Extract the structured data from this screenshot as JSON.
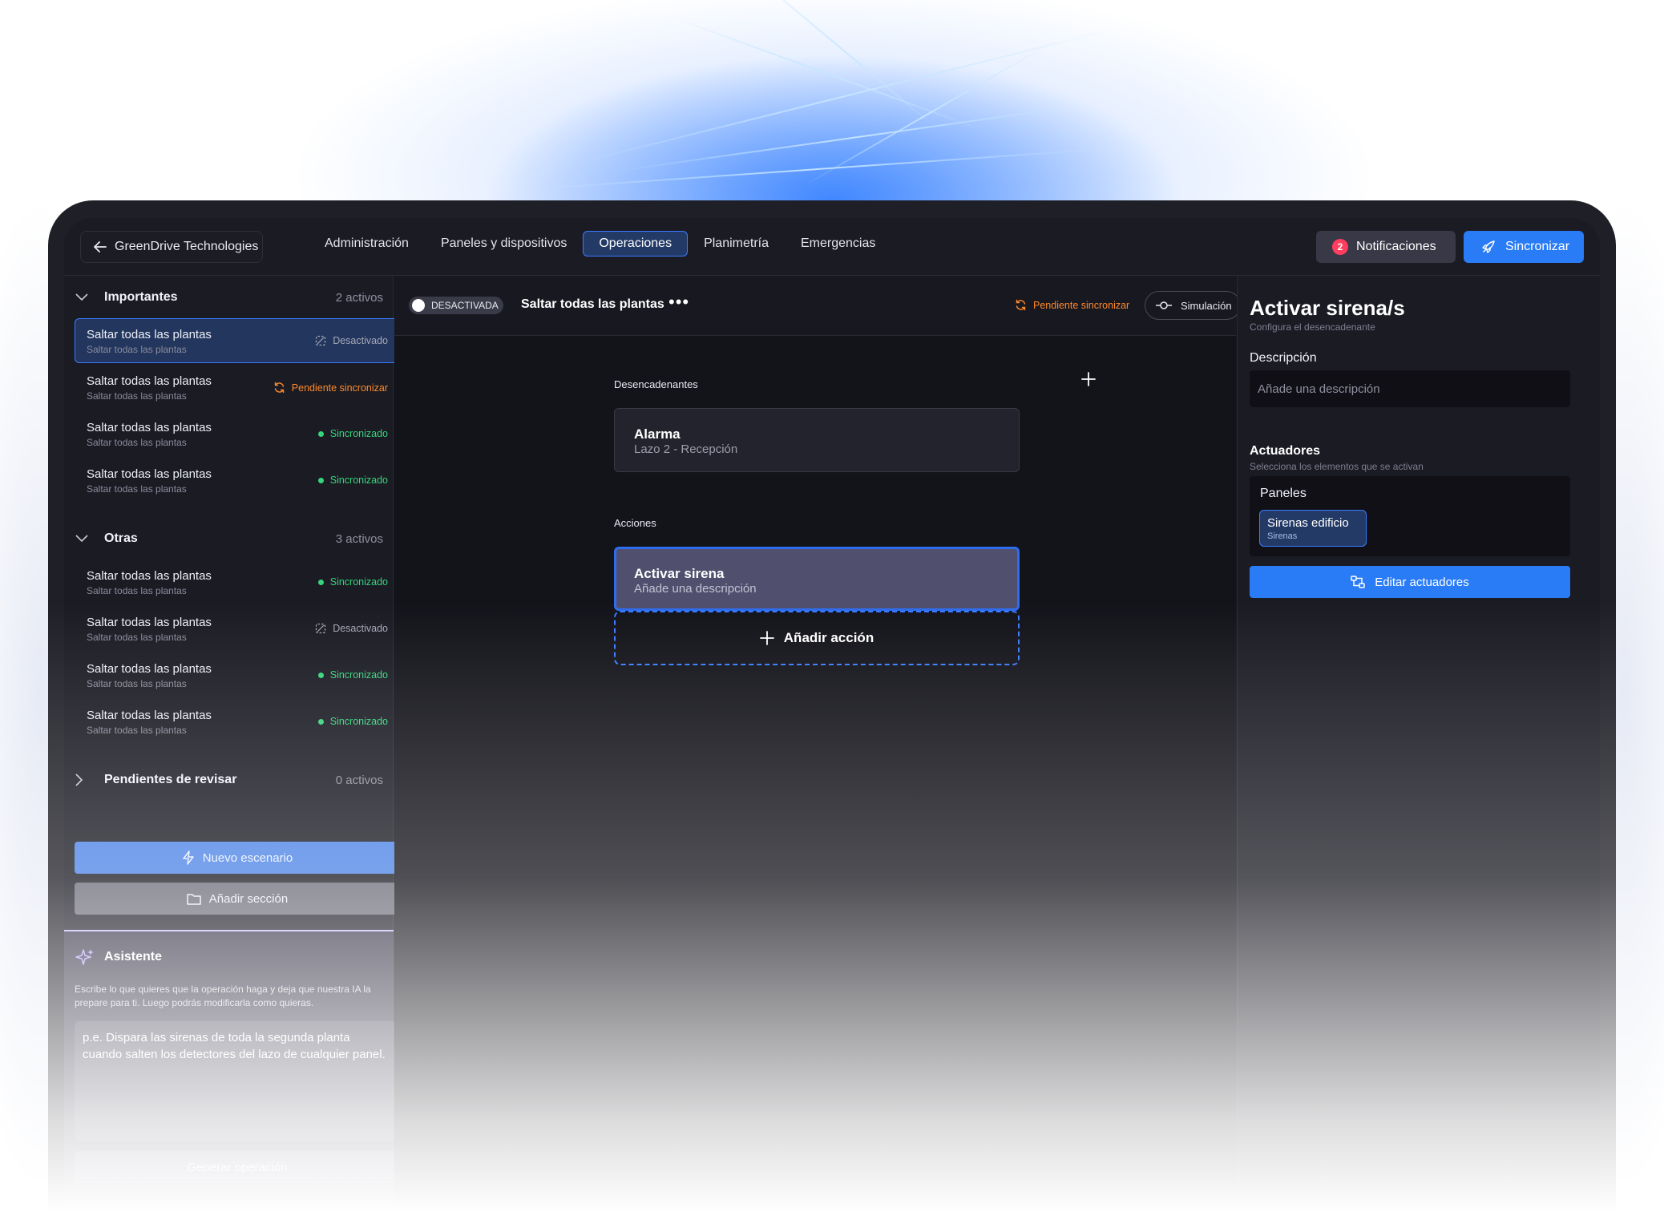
{
  "header": {
    "back_label": "GreenDrive Technologies",
    "nav": [
      {
        "label": "Administración"
      },
      {
        "label": "Paneles y dispositivos"
      },
      {
        "label": "Operaciones"
      },
      {
        "label": "Planimetría"
      },
      {
        "label": "Emergencias"
      }
    ],
    "active_tab": "Operaciones",
    "notifications_label": "Notificaciones",
    "notifications_count": "2",
    "sync_label": "Sincronizar"
  },
  "sidebar": {
    "sections": [
      {
        "title": "Importantes",
        "count": "2 activos",
        "expanded": true,
        "items": [
          {
            "title": "Saltar todas las plantas",
            "subtitle": "Saltar todas las plantas",
            "status": "Desactivado",
            "selected": true
          },
          {
            "title": "Saltar todas las plantas",
            "subtitle": "Saltar todas las plantas",
            "status": "Pendiente sincronizar"
          },
          {
            "title": "Saltar todas las plantas",
            "subtitle": "Saltar todas las plantas",
            "status": "Sincronizado"
          },
          {
            "title": "Saltar todas las plantas",
            "subtitle": "Saltar todas las plantas",
            "status": "Sincronizado"
          }
        ]
      },
      {
        "title": "Otras",
        "count": "3 activos",
        "expanded": true,
        "items": [
          {
            "title": "Saltar todas las plantas",
            "subtitle": "Saltar todas las plantas",
            "status": "Sincronizado"
          },
          {
            "title": "Saltar todas las plantas",
            "subtitle": "Saltar todas las plantas",
            "status": "Desactivado"
          },
          {
            "title": "Saltar todas las plantas",
            "subtitle": "Saltar todas las plantas",
            "status": "Sincronizado"
          },
          {
            "title": "Saltar todas las plantas",
            "subtitle": "Saltar todas las plantas",
            "status": "Sincronizado"
          }
        ]
      },
      {
        "title": "Pendientes de revisar",
        "count": "0 activos",
        "expanded": false,
        "items": []
      }
    ],
    "new_scenario_label": "Nuevo escenario",
    "add_section_label": "Añadir sección",
    "assistant": {
      "title": "Asistente",
      "description": "Escribe lo que quieres que la operación haga y deja que nuestra IA la prepare para ti. Luego podrás modificarla como quieras.",
      "placeholder": "p.e. Dispara las sirenas de toda la segunda planta cuando salten los detectores del lazo de cualquier panel.",
      "generate_label": "Generar operación"
    }
  },
  "center": {
    "toggle_label": "DESACTIVADA",
    "operation_name": "Saltar todas las plantas",
    "more_label": "•••",
    "pending_label": "Pendiente sincronizar",
    "simulation_label": "Simulación",
    "triggers_label": "Desencadenantes",
    "trigger": {
      "title": "Alarma",
      "subtitle": "Lazo 2 - Recepción"
    },
    "actions_label": "Acciones",
    "action": {
      "title": "Activar sirena",
      "subtitle": "Añade una descripción"
    },
    "add_action_label": "Añadir acción"
  },
  "panel": {
    "title": "Activar sirena/s",
    "subtitle": "Configura el desencadenante",
    "description_label": "Descripción",
    "description_placeholder": "Añade una descripción",
    "actuators_title": "Actuadores",
    "actuators_hint": "Selecciona los elementos que se activan",
    "group_title": "Paneles",
    "chip_title": "Sirenas edificio",
    "chip_sub": "Sirenas",
    "edit_label": "Editar actuadores"
  },
  "colors": {
    "accent": "#2a7cf6",
    "pending": "#ff8a2a",
    "synced": "#36d57c",
    "badge": "#ff3d5e"
  }
}
